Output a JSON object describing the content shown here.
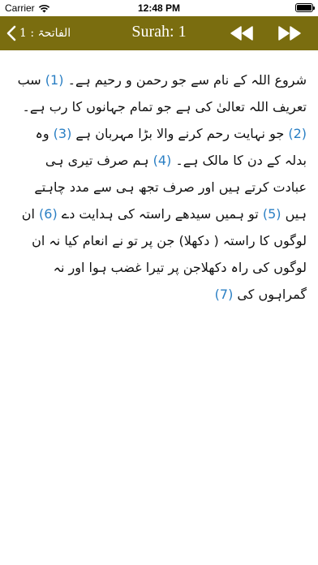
{
  "status": {
    "carrier": "Carrier",
    "time": "12:48 PM"
  },
  "nav": {
    "back_label": "الفاتحۃ : 1",
    "title": "Surah: 1",
    "icons": {
      "back": "chevron-left-icon",
      "prev": "rewind-icon",
      "next": "fast-forward-icon"
    }
  },
  "colors": {
    "navbar": "#7a6d0f",
    "verse_number": "#2a7fc4"
  },
  "verses": [
    {
      "text": "شروع اللہ کے نام سے جو رحمن و رحیم ہے۔ ",
      "num": "(1)"
    },
    {
      "text": " سب تعریف اللہ تعالیٰ کی ہے جو تمام جہانوں کا رب ہے۔ ",
      "num": "(2)"
    },
    {
      "text": " جو نہایت رحم کرنے والا بڑا مہربان ہے ",
      "num": "(3)"
    },
    {
      "text": " وہ بدلہ کے دن کا مالک ہے۔ ",
      "num": "(4)"
    },
    {
      "text": " ہم صرف تیری ہی عبادت کرتے ہیں اور صرف تجھ ہی سے مدد چاہتے ہیں ",
      "num": "(5)"
    },
    {
      "text": " تو ہمیں سیدھے راستہ کی ہدایت دے ",
      "num": "(6)"
    },
    {
      "text": " ان لوگوں کا راستہ ( دکھلا) جن پر تو نے انعام کیا نہ ان لوگوں کی راہ دکھلاجن پر تیرا غضب ہوا اور نہ گمراہوں کی ",
      "num": "(7)"
    }
  ]
}
